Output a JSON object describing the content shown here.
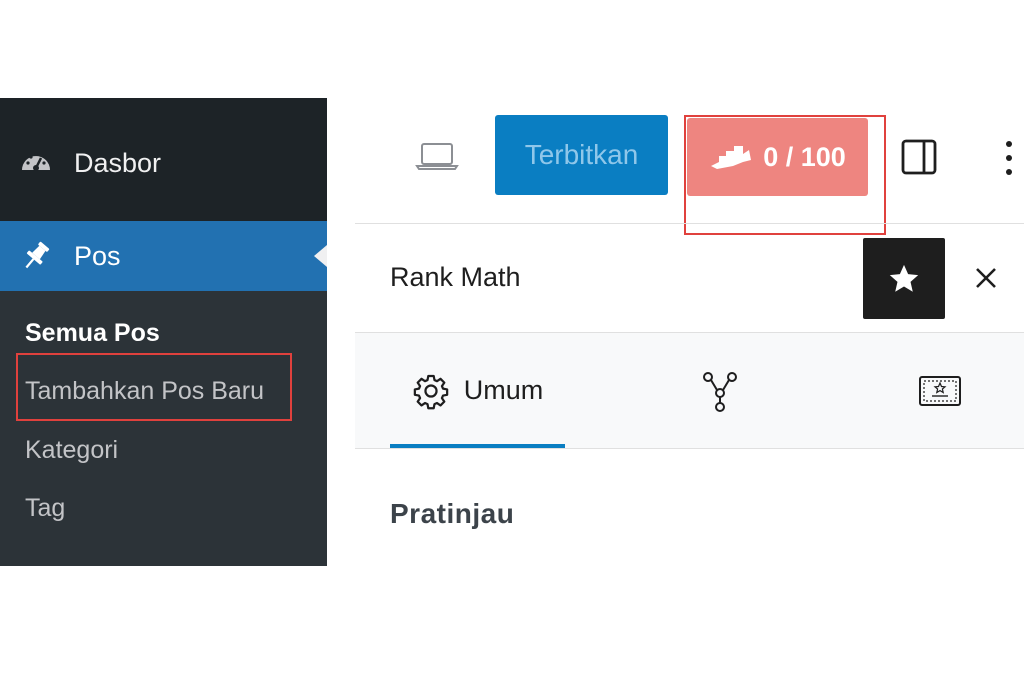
{
  "admin_menu": {
    "dashboard_label": "Dasbor",
    "posts_label": "Pos",
    "submenu": {
      "all_posts": "Semua Pos",
      "add_new": "Tambahkan Pos Baru",
      "categories": "Kategori",
      "tags": "Tag"
    }
  },
  "toolbar": {
    "publish_label": "Terbitkan",
    "seo_score": "0 / 100"
  },
  "panel": {
    "title": "Rank Math",
    "tabs": [
      {
        "label": "Umum",
        "icon": "gear-icon",
        "active": true
      },
      {
        "label": "",
        "icon": "schema-icon",
        "active": false
      },
      {
        "label": "",
        "icon": "social-card-icon",
        "active": false
      }
    ],
    "section_title": "Pratinjau"
  },
  "colors": {
    "menu_bg": "#2c3338",
    "menu_active": "#2271b1",
    "publish": "#0a7ec2",
    "score_bad": "#ee8580",
    "highlight": "#e0413d"
  }
}
